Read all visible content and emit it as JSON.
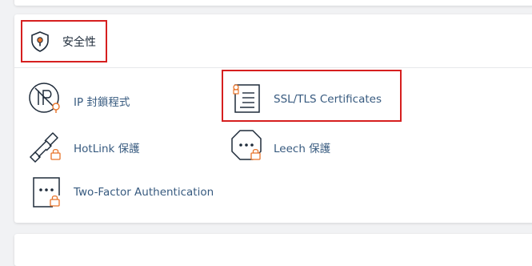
{
  "section": {
    "title": "安全性",
    "icon": "shield-lock-icon"
  },
  "items": [
    {
      "label": "IP 封鎖程式",
      "icon": "ip-blocker-icon"
    },
    {
      "label": "SSL/TLS Certificates",
      "icon": "certificate-icon"
    },
    {
      "label": "HotLink 保護",
      "icon": "hotlink-chain-icon"
    },
    {
      "label": "Leech 保護",
      "icon": "leech-octagon-icon"
    },
    {
      "label": "Two-Factor Authentication",
      "icon": "two-factor-icon"
    }
  ],
  "colors": {
    "highlight": "#d61f1f",
    "accent": "#e8742a",
    "link": "#375a7f",
    "heading": "#1e2b3a"
  }
}
